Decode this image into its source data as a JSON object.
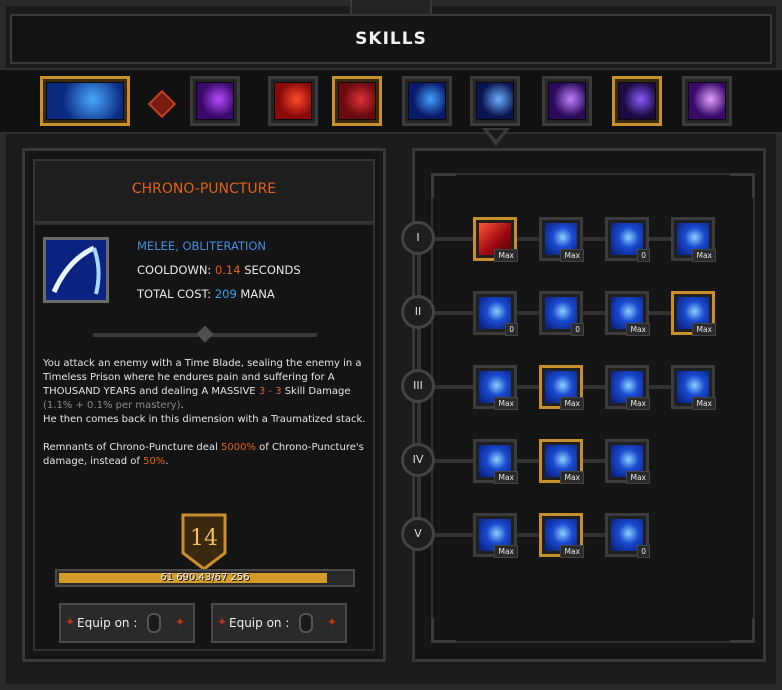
{
  "title": "SKILLS",
  "tabs": [
    {
      "icon": "comet-icon",
      "gold": true,
      "colors": [
        "#0a2a80",
        "#4aa8ff"
      ]
    },
    {
      "icon": "purple-blade-icon",
      "gold": false,
      "colors": [
        "#3a0a6a",
        "#b84aff"
      ]
    },
    {
      "icon": "red-slash-icon",
      "gold": false,
      "colors": [
        "#8a0a0a",
        "#ff4a2a"
      ]
    },
    {
      "icon": "red-tome-icon",
      "gold": true,
      "colors": [
        "#6a0a10",
        "#e0303a"
      ]
    },
    {
      "icon": "blue-ring-icon",
      "gold": false,
      "colors": [
        "#0a1a6a",
        "#40a0ff"
      ]
    },
    {
      "icon": "blue-arc-icon",
      "gold": false,
      "colors": [
        "#0a1450",
        "#6ab0ff"
      ]
    },
    {
      "icon": "purple-crescent-icon",
      "gold": false,
      "colors": [
        "#2a0a5a",
        "#c080ff"
      ]
    },
    {
      "icon": "violet-moon-icon",
      "gold": true,
      "colors": [
        "#1a0a40",
        "#8a5aff"
      ]
    },
    {
      "icon": "violet-orb-icon",
      "gold": false,
      "colors": [
        "#3a0a6a",
        "#e0a0ff"
      ]
    }
  ],
  "skill": {
    "name": "CHRONO-PUNCTURE",
    "tags": "MELEE, OBLITERATION",
    "cooldown_label": "COOLDOWN:",
    "cooldown_value": "0.14",
    "cooldown_unit": "SECONDS",
    "cost_label": "TOTAL COST:",
    "cost_value": "209",
    "cost_unit": "MANA",
    "desc": {
      "p1a": "You attack an enemy with a Time Blade, sealing the enemy in a Timeless Prison where he endures pain and suffering for A THOUSAND YEARS and dealing A MASSIVE ",
      "dmg": "3 - 3",
      "p1b": " Skill Damage ",
      "scaling": "(1.1% + 0.1% per mastery)",
      "p1c": ".",
      "p2": "He then comes back in this dimension with a Traumatized stack.",
      "p3a": "Remnants of Chrono-Puncture deal ",
      "pct1": "5000%",
      "p3b": " of Chrono-Puncture's damage, instead of ",
      "pct2": "50%",
      "p3c": "."
    },
    "level": "14",
    "xp_text": "61 690.43/67 256",
    "xp_fraction": 0.917,
    "equip1": "Equip on :",
    "equip2": "Equip on :"
  },
  "tree": [
    {
      "tier": "I",
      "nodes": [
        {
          "gold": true,
          "lv": "Max",
          "icon": "red-claw-icon",
          "red": true
        },
        {
          "gold": false,
          "lv": "Max",
          "icon": "blue-shards-icon"
        },
        {
          "gold": false,
          "lv": "0",
          "icon": "blue-bolts-icon"
        },
        {
          "gold": false,
          "lv": "Max",
          "icon": "blue-cluster-icon"
        }
      ]
    },
    {
      "tier": "II",
      "nodes": [
        {
          "gold": false,
          "lv": "0",
          "icon": "blue-drop-icon"
        },
        {
          "gold": false,
          "lv": "0",
          "icon": "blue-hook-icon"
        },
        {
          "gold": false,
          "lv": "Max",
          "icon": "blue-sparks-icon"
        },
        {
          "gold": true,
          "lv": "Max",
          "icon": "blue-rays-icon"
        }
      ]
    },
    {
      "tier": "III",
      "nodes": [
        {
          "gold": false,
          "lv": "Max",
          "icon": "blue-crown-icon"
        },
        {
          "gold": true,
          "lv": "Max",
          "icon": "blue-slash-icon"
        },
        {
          "gold": false,
          "lv": "Max",
          "icon": "blue-burst-icon"
        },
        {
          "gold": false,
          "lv": "Max",
          "icon": "blue-rings-icon"
        }
      ]
    },
    {
      "tier": "IV",
      "nodes": [
        {
          "gold": false,
          "lv": "Max",
          "icon": "blue-skull-icon"
        },
        {
          "gold": true,
          "lv": "Max",
          "icon": "blue-flask-icon"
        },
        {
          "gold": false,
          "lv": "Max",
          "icon": "blue-orb-icon"
        }
      ]
    },
    {
      "tier": "V",
      "nodes": [
        {
          "gold": false,
          "lv": "Max",
          "icon": "blue-bars-icon"
        },
        {
          "gold": true,
          "lv": "Max",
          "icon": "blue-wave-icon"
        },
        {
          "gold": false,
          "lv": "0",
          "icon": "blue-axe-icon"
        }
      ]
    }
  ]
}
